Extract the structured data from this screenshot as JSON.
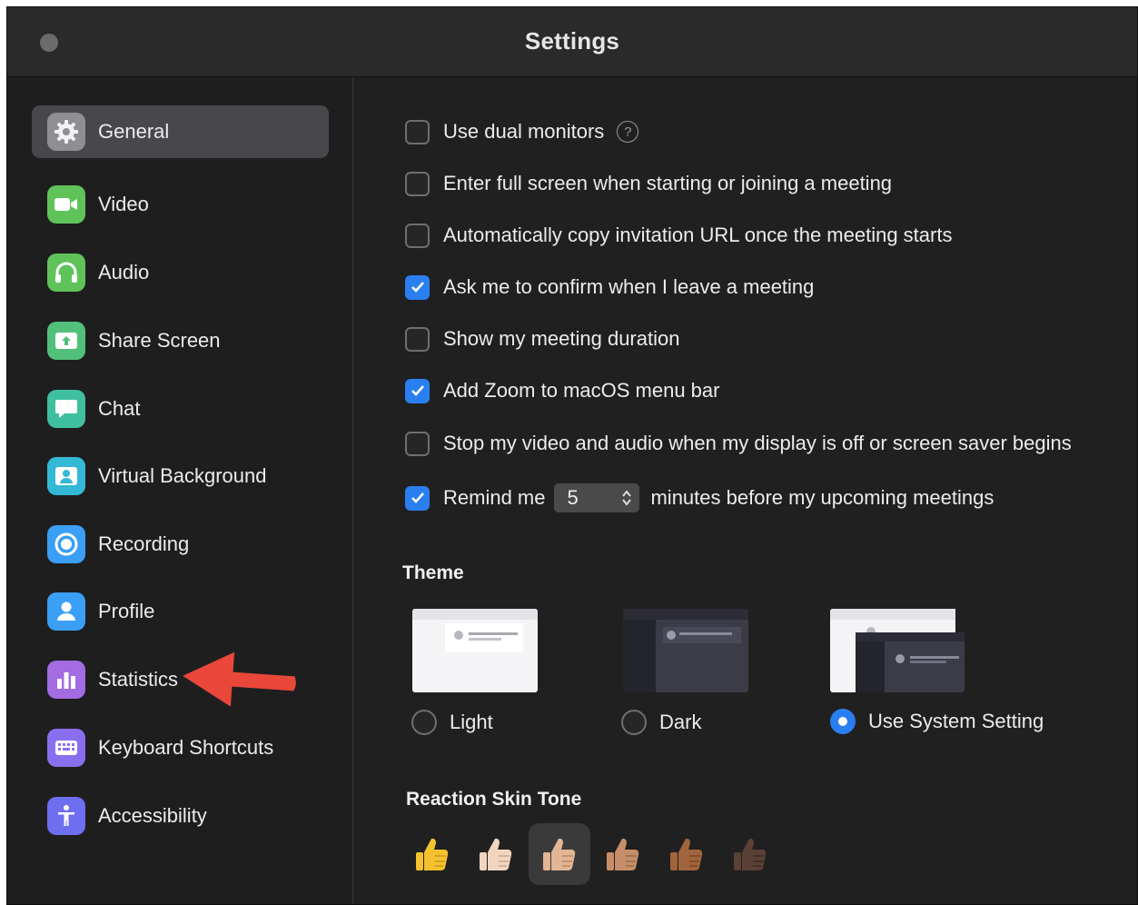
{
  "window": {
    "title": "Settings"
  },
  "sidebar": {
    "items": [
      {
        "label": "General",
        "icon": "gear-icon",
        "color": "#8e8e93",
        "active": true
      },
      {
        "label": "Video",
        "icon": "video-camera-icon",
        "color": "#5fc35a"
      },
      {
        "label": "Audio",
        "icon": "headphones-icon",
        "color": "#5fc35a"
      },
      {
        "label": "Share Screen",
        "icon": "share-screen-icon",
        "color": "#52c07a"
      },
      {
        "label": "Chat",
        "icon": "chat-bubble-icon",
        "color": "#3fbf9e"
      },
      {
        "label": "Virtual Background",
        "icon": "person-portrait-icon",
        "color": "#33b8d6"
      },
      {
        "label": "Recording",
        "icon": "record-icon",
        "color": "#3a9ff5"
      },
      {
        "label": "Profile",
        "icon": "person-icon",
        "color": "#3a9ff5"
      },
      {
        "label": "Statistics",
        "icon": "bar-chart-icon",
        "color": "#a36ce0"
      },
      {
        "label": "Keyboard Shortcuts",
        "icon": "keyboard-icon",
        "color": "#8a6ef0"
      },
      {
        "label": "Accessibility",
        "icon": "accessibility-icon",
        "color": "#6d6ef0"
      }
    ]
  },
  "general": {
    "options": [
      {
        "label": "Use dual monitors",
        "checked": false,
        "help": "?"
      },
      {
        "label": "Enter full screen when starting or joining a meeting",
        "checked": false
      },
      {
        "label": "Automatically copy invitation URL once the meeting starts",
        "checked": false
      },
      {
        "label": "Ask me to confirm when I leave a meeting",
        "checked": true
      },
      {
        "label": "Show my meeting duration",
        "checked": false
      },
      {
        "label": "Add Zoom to macOS menu bar",
        "checked": true
      },
      {
        "label": "Stop my video and audio when my display is off or screen saver begins",
        "checked": false
      }
    ],
    "reminder": {
      "label_before": "Remind me",
      "value": "5",
      "label_after": "minutes before my upcoming meetings",
      "checked": true
    },
    "theme": {
      "title": "Theme",
      "options": [
        {
          "label": "Light",
          "selected": false
        },
        {
          "label": "Dark",
          "selected": false
        },
        {
          "label": "Use System Setting",
          "selected": true
        }
      ]
    },
    "skin_tone": {
      "title": "Reaction Skin Tone",
      "tones": [
        "#f5c12e",
        "#f2d5bf",
        "#e2b594",
        "#c68e68",
        "#a0653c",
        "#5a4036"
      ],
      "selected_index": 2
    }
  },
  "colors": {
    "accent": "#2a7ff0",
    "annotation_arrow": "#e8473a"
  }
}
